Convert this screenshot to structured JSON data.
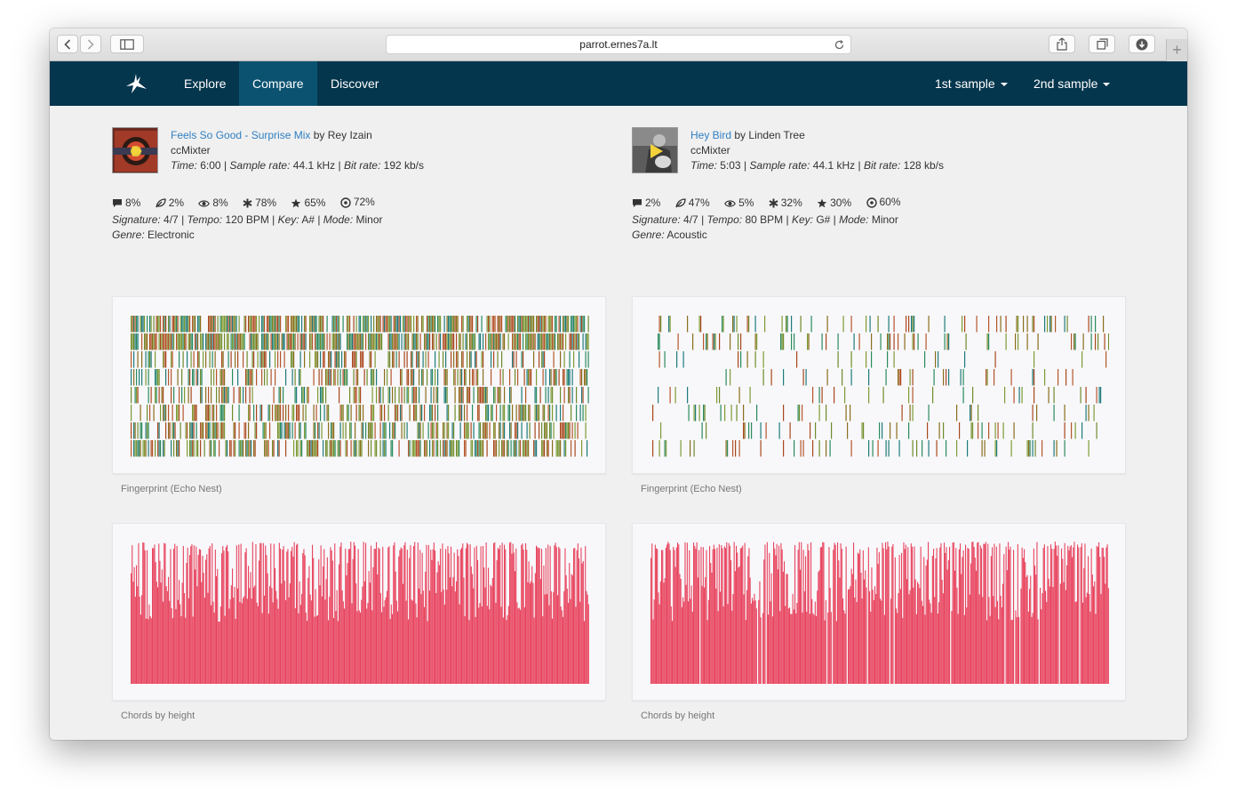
{
  "browser": {
    "url": "parrot.ernes7a.lt"
  },
  "navbar": {
    "items": [
      "Explore",
      "Compare",
      "Discover"
    ],
    "active": "Compare",
    "right_items": [
      "1st sample",
      "2nd sample"
    ]
  },
  "samples": [
    {
      "title": "Feels So Good - Surprise Mix",
      "by": "by",
      "artist": "Rey Izain",
      "source": "ccMixter",
      "time_label": "Time:",
      "time": "6:00",
      "sample_rate_label": "Sample rate:",
      "sample_rate": "44.1 kHz",
      "bit_rate_label": "Bit rate:",
      "bit_rate": "192 kb/s",
      "stats": [
        "8%",
        "2%",
        "8%",
        "78%",
        "65%",
        "72%"
      ],
      "signature_label": "Signature:",
      "signature": "4/7",
      "tempo_label": "Tempo:",
      "tempo": "120 BPM",
      "key_label": "Key:",
      "key": "A#",
      "mode_label": "Mode:",
      "mode": "Minor",
      "genre_label": "Genre:",
      "genre": "Electronic",
      "fingerprint_caption": "Fingerprint (Echo Nest)",
      "chords_caption": "Chords by height"
    },
    {
      "title": "Hey Bird",
      "by": "by",
      "artist": "Linden Tree",
      "source": "ccMixter",
      "time_label": "Time:",
      "time": "5:03",
      "sample_rate_label": "Sample rate:",
      "sample_rate": "44.1 kHz",
      "bit_rate_label": "Bit rate:",
      "bit_rate": "128 kb/s",
      "stats": [
        "2%",
        "47%",
        "5%",
        "32%",
        "30%",
        "60%"
      ],
      "signature_label": "Signature:",
      "signature": "4/7",
      "tempo_label": "Tempo:",
      "tempo": "80 BPM",
      "key_label": "Key:",
      "key": "G#",
      "mode_label": "Mode:",
      "mode": "Minor",
      "genre_label": "Genre:",
      "genre": "Acoustic",
      "fingerprint_caption": "Fingerprint (Echo Nest)",
      "chords_caption": "Chords by height"
    }
  ],
  "colors": {
    "navbar": "#04364d",
    "navbar_active": "#0b5270",
    "link": "#2f7fc1",
    "chord_bar": "#e8445e",
    "fingerprint_palette": [
      "#8a6d1a",
      "#a8471c",
      "#6f8a2a",
      "#2a8a5c",
      "#1f7a7a",
      "#b5552b",
      "#7d9a34"
    ]
  },
  "icons": [
    "comment-icon",
    "leaf-icon",
    "eye-icon",
    "asterisk-icon",
    "star-icon",
    "target-icon"
  ]
}
